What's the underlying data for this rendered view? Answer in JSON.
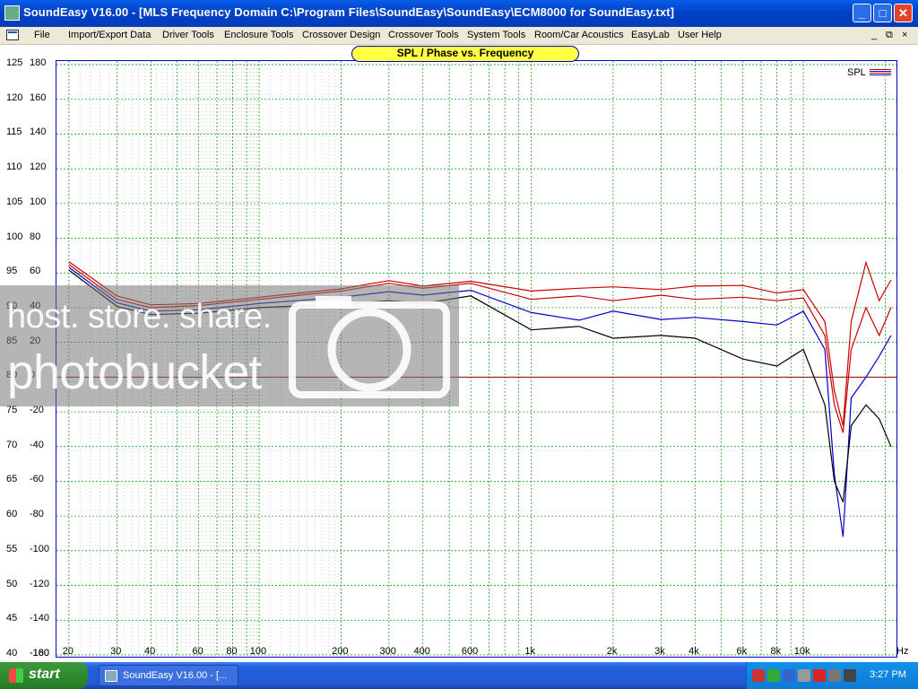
{
  "window": {
    "title": "SoundEasy V16.00 - [MLS Frequency Domain  C:\\Program Files\\SoundEasy\\SoundEasy\\ECM8000 for SoundEasy.txt]",
    "minimize_glyph": "_",
    "maximize_glyph": "□",
    "close_glyph": "✕"
  },
  "menu": {
    "items": [
      "File",
      "Import/Export Data",
      "Driver Tools",
      "Enclosure Tools",
      "Crossover Design",
      "Crossover Tools",
      "System Tools",
      "Room/Car Acoustics",
      "EasyLab",
      "User Help"
    ],
    "mdi_minimize": "_",
    "mdi_restore": "⧉",
    "mdi_close": "×"
  },
  "chart_data": {
    "type": "line",
    "title": "SPL / Phase vs. Frequency",
    "legend": [
      "SPL"
    ],
    "legend_position": "top-right",
    "x_scale": "log",
    "xlim": [
      18,
      22000
    ],
    "x_ticks": [
      {
        "v": 20,
        "label": "20"
      },
      {
        "v": 30,
        "label": "30"
      },
      {
        "v": 40,
        "label": "40"
      },
      {
        "v": 60,
        "label": "60"
      },
      {
        "v": 80,
        "label": "80"
      },
      {
        "v": 100,
        "label": "100"
      },
      {
        "v": 200,
        "label": "200"
      },
      {
        "v": 300,
        "label": "300"
      },
      {
        "v": 400,
        "label": "400"
      },
      {
        "v": 600,
        "label": "600"
      },
      {
        "v": 1000,
        "label": "1k"
      },
      {
        "v": 2000,
        "label": "2k"
      },
      {
        "v": 3000,
        "label": "3k"
      },
      {
        "v": 4000,
        "label": "4k"
      },
      {
        "v": 6000,
        "label": "6k"
      },
      {
        "v": 8000,
        "label": "8k"
      },
      {
        "v": 10000,
        "label": "10k"
      }
    ],
    "x_unit": "Hz",
    "y_ticks_spl": [
      "125",
      "120",
      "115",
      "110",
      "105",
      "100",
      "95",
      "90",
      "85",
      "80",
      "75",
      "70",
      "65",
      "60",
      "55",
      "50",
      "45",
      "40"
    ],
    "y_ticks_phase": [
      "180",
      "160",
      "140",
      "120",
      "100",
      "80",
      "60",
      "40",
      "20",
      "0",
      "-20",
      "-40",
      "-60",
      "-80",
      "-100",
      "-120",
      "-140",
      "-160",
      "-180"
    ],
    "y_unit_spl": "dB",
    "y_unit_phase": "deg",
    "ylim_spl": [
      40,
      125
    ],
    "ylim_phase": [
      -180,
      180
    ],
    "reference_line_spl": 80,
    "grid": true,
    "series": [
      {
        "name": "SPL",
        "color": "#cc0000",
        "x": [
          20,
          30,
          40,
          60,
          100,
          200,
          300,
          400,
          600,
          1000,
          1500,
          2000,
          3000,
          4000,
          6000,
          8000,
          10000,
          12000,
          13000,
          14000,
          15000,
          17000,
          19000,
          21000
        ],
        "y": [
          96.6,
          91.7,
          90.4,
          90.6,
          91.5,
          92.7,
          93.9,
          93.1,
          93.8,
          92.4,
          92.8,
          93.0,
          92.6,
          93.1,
          93.2,
          92.1,
          92.6,
          88.0,
          78.0,
          73.0,
          88.0,
          96.5,
          91.0,
          94.0
        ]
      },
      {
        "color": "#cc0000",
        "x": [
          20,
          30,
          40,
          60,
          100,
          200,
          300,
          400,
          600,
          1000,
          1500,
          2000,
          3000,
          4000,
          6000,
          8000,
          10000,
          12000,
          13000,
          14000,
          15000,
          17000,
          19000,
          21000
        ],
        "y": [
          96.2,
          91.2,
          90.0,
          90.3,
          91.2,
          92.4,
          93.5,
          92.8,
          93.5,
          91.2,
          91.7,
          91.0,
          91.8,
          91.2,
          91.5,
          91.0,
          91.4,
          86.0,
          76.0,
          72.0,
          84.0,
          90.0,
          86.0,
          90.0
        ]
      },
      {
        "color": "#0000cc",
        "x": [
          20,
          30,
          40,
          60,
          100,
          200,
          300,
          400,
          600,
          1000,
          1500,
          2000,
          3000,
          4000,
          6000,
          8000,
          10000,
          12000,
          13000,
          14000,
          15000,
          17000,
          19000,
          21000
        ],
        "y": [
          95.8,
          90.7,
          89.5,
          89.7,
          90.6,
          91.5,
          92.3,
          91.8,
          92.5,
          89.3,
          88.2,
          89.5,
          88.3,
          88.6,
          88.0,
          87.5,
          89.5,
          84.0,
          66.0,
          57.0,
          77.0,
          80.0,
          83.0,
          86.0
        ]
      },
      {
        "color": "#000000",
        "x": [
          20,
          30,
          40,
          60,
          100,
          200,
          300,
          400,
          600,
          1000,
          1500,
          2000,
          3000,
          4000,
          6000,
          8000,
          10000,
          12000,
          13000,
          14000,
          15000,
          17000,
          19000,
          21000
        ],
        "y": [
          95.4,
          90.2,
          89.0,
          89.2,
          90.0,
          90.5,
          91.0,
          90.6,
          91.7,
          86.8,
          87.3,
          85.6,
          86.0,
          85.6,
          82.6,
          81.6,
          84.0,
          76.0,
          65.0,
          62.0,
          73.0,
          76.0,
          74.0,
          70.0
        ]
      }
    ]
  },
  "watermark": {
    "line1": "host. store. share.",
    "line2": "photobucket"
  },
  "taskbar": {
    "start_label": "start",
    "task_label": "SoundEasy V16.00 - [...",
    "clock": "3:27 PM",
    "tray_icons": [
      "network-icon",
      "volume-icon",
      "security-icon",
      "app-icon",
      "arrow-icon",
      "sync-icon",
      "speaker-icon"
    ]
  }
}
